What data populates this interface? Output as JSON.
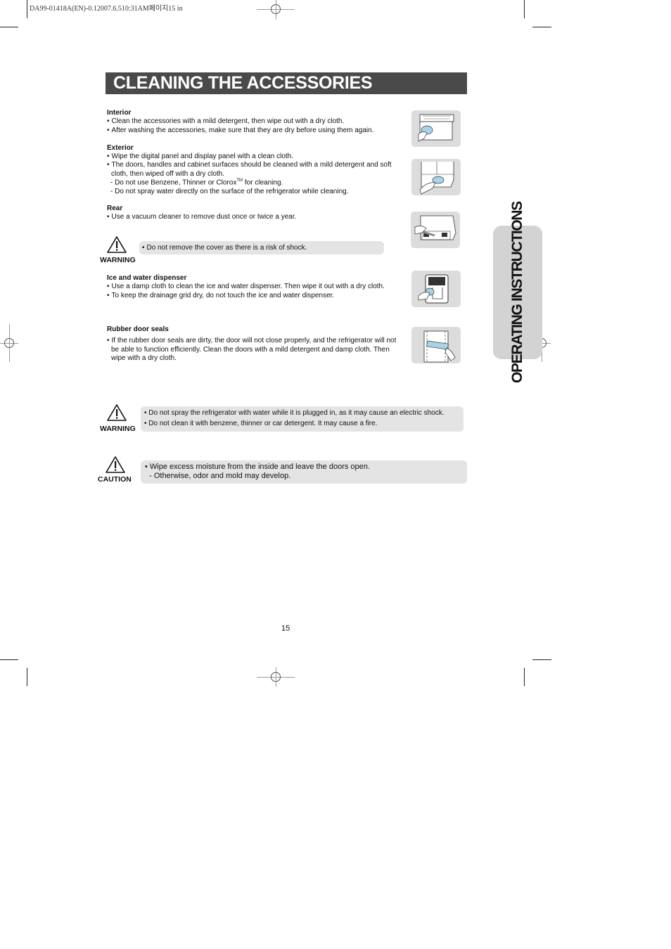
{
  "print_header": "DA99-01418A(EN)-0.12007.6.510:31AM페이지15  in",
  "title": "CLEANING THE ACCESSORIES",
  "side_tab": "OPERATING INSTRUCTIONS",
  "sections": {
    "interior": {
      "heading": "Interior",
      "items": [
        "Clean the accessories with a mild detergent, then wipe out with a dry cloth.",
        "After washing the accessories, make sure that they are dry before using them again."
      ]
    },
    "exterior": {
      "heading": "Exterior",
      "items": [
        "Wipe the digital panel and display panel with a clean cloth.",
        "The doors, handles and cabinet surfaces should be cleaned with a mild detergent and soft",
        "cloth, then wiped off with a dry cloth.",
        "- Do not use Benzene, Thinner or Clorox",
        "TM",
        "for cleaning.",
        "- Do not spray water directly on the surface of the refrigerator while cleaning."
      ]
    },
    "rear": {
      "heading": "Rear",
      "items": [
        "Use a vacuum cleaner to remove dust once or twice a year."
      ]
    },
    "ice_water": {
      "heading": "Ice and water dispenser",
      "items": [
        "Use a damp cloth to clean the ice and water dispenser. Then wipe it out with a dry cloth.",
        "To keep the drainage grid dry, do not touch the ice and water dispenser."
      ]
    },
    "rubber_seals": {
      "heading": "Rubber door seals",
      "items": [
        "If the rubber door seals are dirty, the door will not close properly, and the refrigerator will not",
        "be able to function efficiently. Clean the doors with a mild detergent and damp cloth. Then",
        "wipe with a dry cloth."
      ]
    }
  },
  "notices": {
    "warning1": {
      "label": "WARNING",
      "lines": [
        "Do not remove the cover as there is a risk of shock."
      ]
    },
    "warning2": {
      "label": "WARNING",
      "lines": [
        "• Do not spray the refrigerator with water while it is plugged in, as it may cause an electric shock.",
        "• Do not clean it with benzene, thinner or car detergent. It may cause a fire."
      ]
    },
    "caution": {
      "label": "CAUTION",
      "lines": [
        "• Wipe excess moisture from the inside and leave the doors open.",
        "  - Otherwise, odor and mold may develop."
      ]
    }
  },
  "illustrations": [
    "interior-cleaning-illustration",
    "exterior-cleaning-illustration",
    "rear-cleaning-illustration",
    "dispenser-cleaning-illustration",
    "door-seal-cleaning-illustration"
  ],
  "page_number": "15"
}
